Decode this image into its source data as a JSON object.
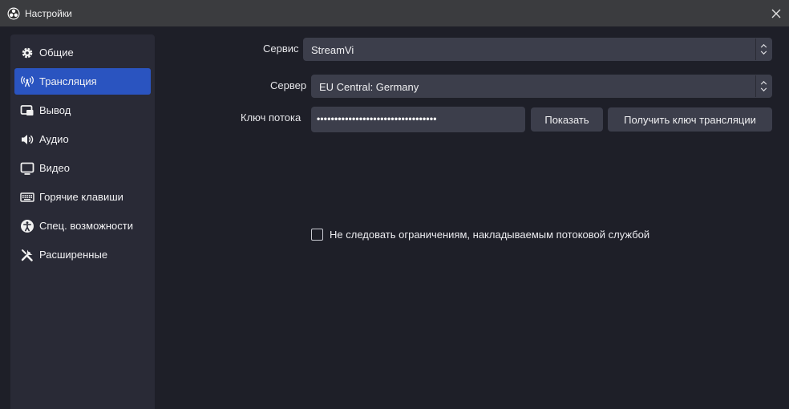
{
  "window": {
    "title": "Настройки",
    "app_icon": "obs-logo-icon",
    "close_icon": "close-icon"
  },
  "sidebar": {
    "items": [
      {
        "label": "Общие",
        "icon": "gear-icon",
        "active": false
      },
      {
        "label": "Трансляция",
        "icon": "antenna-icon",
        "active": true
      },
      {
        "label": "Вывод",
        "icon": "output-icon",
        "active": false
      },
      {
        "label": "Аудио",
        "icon": "speaker-icon",
        "active": false
      },
      {
        "label": "Видео",
        "icon": "monitor-icon",
        "active": false
      },
      {
        "label": "Горячие клавиши",
        "icon": "keyboard-icon",
        "active": false
      },
      {
        "label": "Спец. возможности",
        "icon": "accessibility-icon",
        "active": false
      },
      {
        "label": "Расширенные",
        "icon": "tools-icon",
        "active": false
      }
    ]
  },
  "stream": {
    "service_label": "Сервис",
    "service_value": "StreamVi",
    "server_label": "Сервер",
    "server_value": "EU Central: Germany",
    "key_label": "Ключ потока",
    "key_value": "••••••••••••••••••••••••••••••••••",
    "show_button": "Показать",
    "get_key_button": "Получить ключ трансляции",
    "ignore_limits_label": "Не следовать ограничениям, накладываемым потоковой службой",
    "ignore_limits_checked": false
  },
  "colors": {
    "accent": "#2a54c0",
    "sidebar_bg": "#292a36",
    "field_bg": "#3c3e4b",
    "window_bg": "#1e1f28",
    "titlebar_bg": "#3b3c3f"
  }
}
